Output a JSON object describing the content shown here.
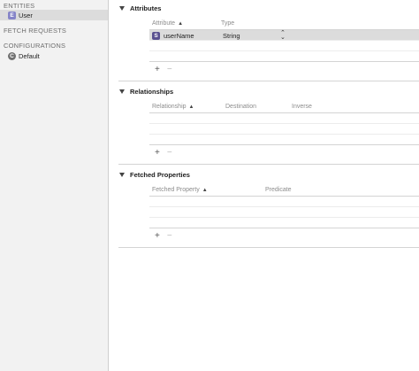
{
  "sidebar": {
    "entities_header": "ENTITIES",
    "entities": [
      {
        "badge": "E",
        "label": "User"
      }
    ],
    "fetch_requests_header": "FETCH REQUESTS",
    "configurations_header": "CONFIGURATIONS",
    "configurations": [
      {
        "badge": "C",
        "label": "Default"
      }
    ]
  },
  "attributes": {
    "title": "Attributes",
    "col_attribute": "Attribute",
    "col_type": "Type",
    "rows": [
      {
        "badge": "S",
        "name": "userName",
        "type": "String"
      }
    ]
  },
  "relationships": {
    "title": "Relationships",
    "col_relationship": "Relationship",
    "col_destination": "Destination",
    "col_inverse": "Inverse"
  },
  "fetched_properties": {
    "title": "Fetched Properties",
    "col_fetched_property": "Fetched Property",
    "col_predicate": "Predicate"
  },
  "controls": {
    "add": "+",
    "remove": "−"
  },
  "icons": {
    "sort": "sort-ascending-icon",
    "disclosure": "disclosure-triangle-icon",
    "stepper": "popup-stepper-icon"
  }
}
